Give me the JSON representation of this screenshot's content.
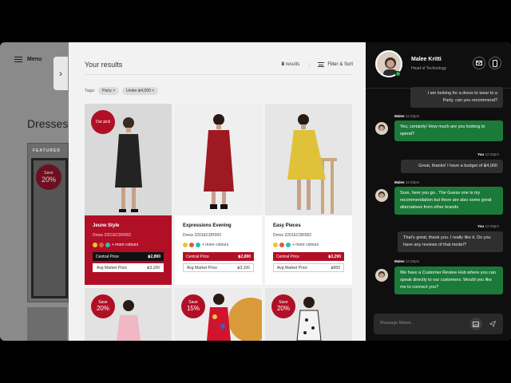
{
  "background": {
    "menu_label": "Menu",
    "page_title": "Dresses",
    "featured_label": "FEATURED",
    "save_label": "Save",
    "save_pct": "20%"
  },
  "results": {
    "title": "Your results",
    "count_num": "8",
    "count_label": "results",
    "filter_label": "Filter & Sort",
    "tags_label": "Tags:",
    "tags": [
      "Party",
      "Under ฿4,000"
    ]
  },
  "products": [
    {
      "badge_text": "Our pick",
      "badge_pct": "",
      "name": "Jeune Style",
      "code": "Dress 2201ECDR002",
      "swatches": [
        "#e8c92a",
        "#d8603a",
        "#2fbcb8"
      ],
      "more": "+ more colours",
      "central_label": "Central Price",
      "central_price": "฿2,890",
      "avg_label": "Avg Market Price",
      "avg_price": "฿3,100"
    },
    {
      "badge_text": "",
      "badge_pct": "",
      "name": "Expressions Evening",
      "code": "Dress 2201ECDR002",
      "swatches": [
        "#e8c92a",
        "#d8603a",
        "#2fbcb8"
      ],
      "more": "+ more colours",
      "central_label": "Central Price",
      "central_price": "฿2,890",
      "avg_label": "Avg Market Price",
      "avg_price": "฿3,100"
    },
    {
      "badge_text": "",
      "badge_pct": "",
      "name": "Easy Pieces",
      "code": "Dress 2201ECDR002",
      "swatches": [
        "#e8c92a",
        "#d8603a",
        "#2fbcb8"
      ],
      "more": "+ more colours",
      "central_label": "Central Price",
      "central_price": "฿3,290",
      "avg_label": "Avg Market Price",
      "avg_price": "฿950"
    },
    {
      "badge_text": "Save",
      "badge_pct": "20%"
    },
    {
      "badge_text": "Save",
      "badge_pct": "15%"
    },
    {
      "badge_text": "Save",
      "badge_pct": "20%"
    }
  ],
  "chat": {
    "name": "Malee Kritti",
    "role": "Head of Technology",
    "messages": [
      {
        "text": "I am looking for a dress to wear to a Party, can you recommend?"
      },
      {
        "sender": "Malee",
        "time": "12:25pm",
        "text": "Yes, certainly! How much are you looking to spend?"
      },
      {
        "sender": "You",
        "time": "12:28pm",
        "text": "Great, thanks! I have a budget of ฿4,000"
      },
      {
        "sender": "Malee",
        "time": "12:28pm",
        "text": "Sure, here you go.. The Guess one is my recommendation but there are also some great alternatives from other brands"
      },
      {
        "sender": "You",
        "time": "12:28pm",
        "text": "That's great, thank you. I really like it. Do you have any reviews of that model?"
      },
      {
        "sender": "Malee",
        "time": "12:28pm",
        "text": "We have a Customer Review Hub where you can speak directly to our customers. Would you like me to connect you?"
      }
    ],
    "input_placeholder": "Message Malee.."
  }
}
